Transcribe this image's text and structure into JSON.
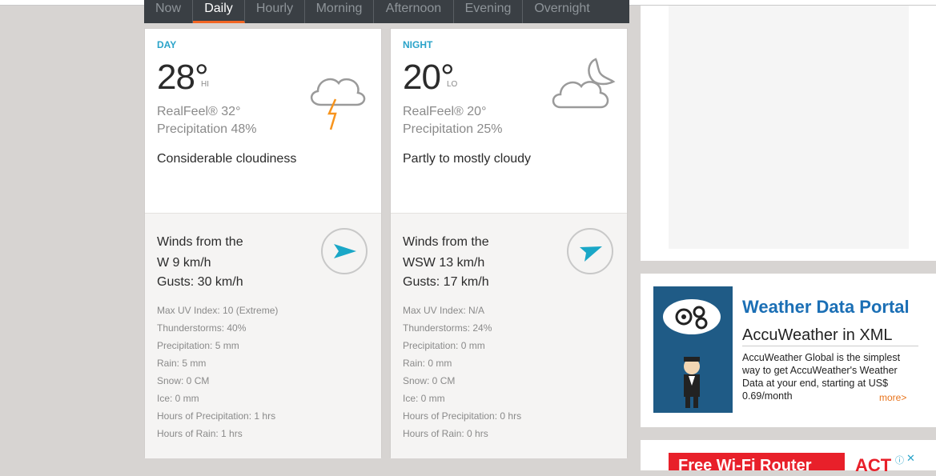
{
  "tabs": [
    "Now",
    "Daily",
    "Hourly",
    "Morning",
    "Afternoon",
    "Evening",
    "Overnight"
  ],
  "active_tab": "Daily",
  "day": {
    "label": "DAY",
    "temp": "28°",
    "hilo": "HI",
    "realfeel": "RealFeel® 32°",
    "precip": "Precipitation 48%",
    "phrase": "Considerable cloudiness",
    "wind_title": "Winds from the",
    "wind": "W 9 km/h",
    "gusts": "Gusts: 30 km/h",
    "details": [
      "Max UV Index: 10 (Extreme)",
      "Thunderstorms: 40%",
      "Precipitation: 5 mm",
      "Rain: 5 mm",
      "Snow: 0 CM",
      "Ice: 0 mm",
      "Hours of Precipitation: 1 hrs",
      "Hours of Rain: 1 hrs"
    ],
    "icon": "thunder-cloud-icon"
  },
  "night": {
    "label": "NIGHT",
    "temp": "20°",
    "hilo": "LO",
    "realfeel": "RealFeel® 20°",
    "precip": "Precipitation 25%",
    "phrase": "Partly to mostly cloudy",
    "wind_title": "Winds from the",
    "wind": "WSW 13 km/h",
    "gusts": "Gusts: 17 km/h",
    "details": [
      "Max UV Index: N/A",
      "Thunderstorms: 24%",
      "Precipitation: 0 mm",
      "Rain: 0 mm",
      "Snow: 0 CM",
      "Ice: 0 mm",
      "Hours of Precipitation: 0 hrs",
      "Hours of Rain: 0 hrs"
    ],
    "icon": "moon-cloud-icon"
  },
  "ad": {
    "title": "Weather Data Portal",
    "subtitle": "AccuWeather in XML",
    "body": "AccuWeather Global is the simplest way to get AccuWeather's Weather Data at your end, starting at US$ 0.69/month",
    "more": "more>"
  },
  "ad2": {
    "text": "Free Wi-Fi Router",
    "logo": "ACT"
  },
  "colors": {
    "accent": "#2aa3c9",
    "tab_active": "#f26522",
    "tabbar": "#3a3f44"
  }
}
